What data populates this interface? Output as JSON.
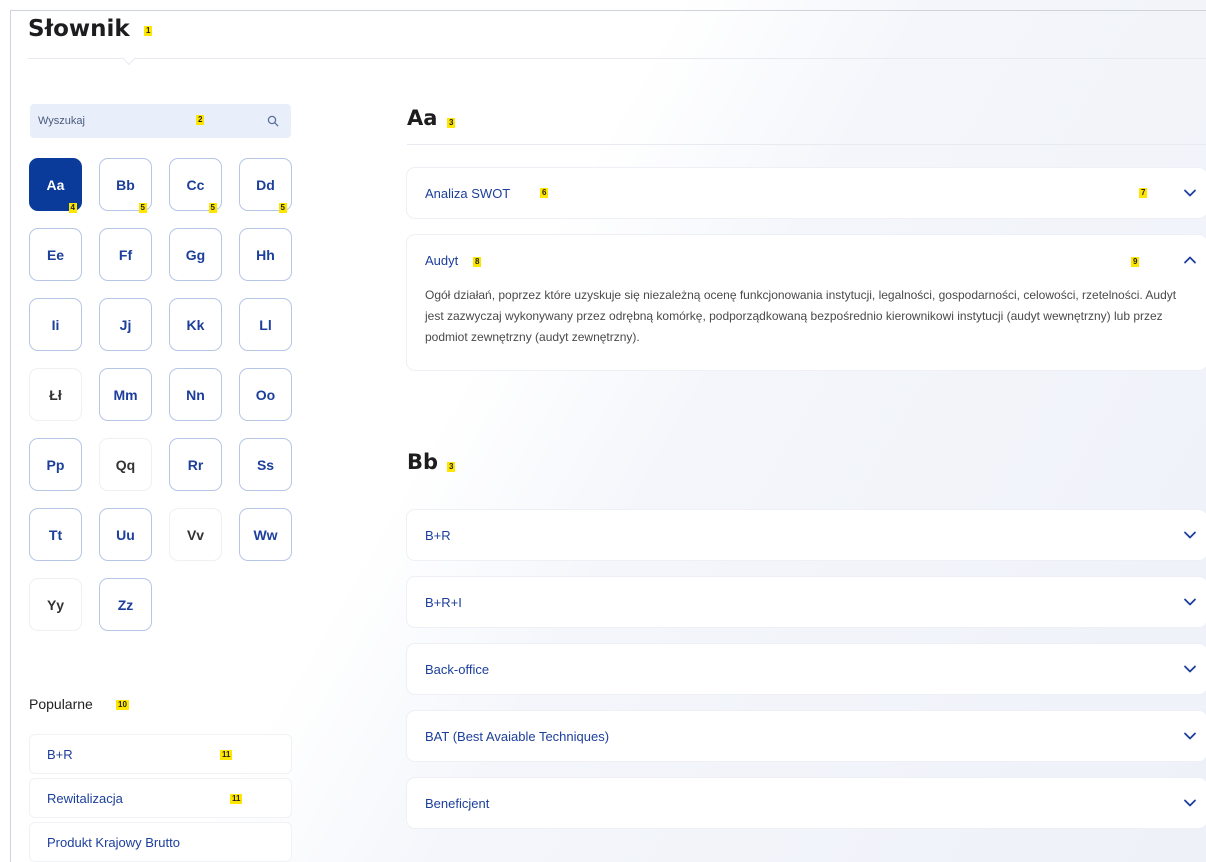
{
  "header": {
    "title": "Słownik",
    "title_marker": "1"
  },
  "search": {
    "placeholder": "Wyszukaj",
    "marker": "2"
  },
  "letters": [
    {
      "label": "Aa",
      "state": "active",
      "marker": "4"
    },
    {
      "label": "Bb",
      "state": "enabled",
      "marker": "5"
    },
    {
      "label": "Cc",
      "state": "enabled",
      "marker": "5"
    },
    {
      "label": "Dd",
      "state": "enabled",
      "marker": "5"
    },
    {
      "label": "Ee",
      "state": "enabled"
    },
    {
      "label": "Ff",
      "state": "enabled"
    },
    {
      "label": "Gg",
      "state": "enabled"
    },
    {
      "label": "Hh",
      "state": "enabled"
    },
    {
      "label": "Ii",
      "state": "enabled"
    },
    {
      "label": "Jj",
      "state": "enabled"
    },
    {
      "label": "Kk",
      "state": "enabled"
    },
    {
      "label": "Ll",
      "state": "enabled"
    },
    {
      "label": "Łł",
      "state": "disabled"
    },
    {
      "label": "Mm",
      "state": "enabled"
    },
    {
      "label": "Nn",
      "state": "enabled"
    },
    {
      "label": "Oo",
      "state": "enabled"
    },
    {
      "label": "Pp",
      "state": "enabled"
    },
    {
      "label": "Qq",
      "state": "disabled"
    },
    {
      "label": "Rr",
      "state": "enabled"
    },
    {
      "label": "Ss",
      "state": "enabled"
    },
    {
      "label": "Tt",
      "state": "enabled"
    },
    {
      "label": "Uu",
      "state": "enabled"
    },
    {
      "label": "Vv",
      "state": "disabled"
    },
    {
      "label": "Ww",
      "state": "enabled"
    },
    {
      "label": "Yy",
      "state": "disabled"
    },
    {
      "label": "Zz",
      "state": "enabled"
    }
  ],
  "popular": {
    "title": "Popularne",
    "marker": "10",
    "items": [
      {
        "label": "B+R",
        "marker": "11"
      },
      {
        "label": "Rewitalizacja",
        "marker": "11"
      },
      {
        "label": "Produkt Krajowy Brutto"
      }
    ]
  },
  "sections": {
    "aa": {
      "title": "Aa",
      "marker": "3",
      "items": {
        "swot": {
          "label": "Analiza SWOT",
          "marker": "6",
          "chevron_marker": "7",
          "expanded": false
        },
        "audyt": {
          "label": "Audyt",
          "marker": "8",
          "chevron_marker": "9",
          "expanded": true,
          "body": "Ogół działań, poprzez które uzyskuje się niezależną ocenę funkcjonowania instytucji, legalności, gospodarności, celowości, rzetelności. Audyt jest zazwyczaj wykonywany przez odrębną komórkę, podporządkowaną bezpośrednio kierownikowi instytucji (audyt wewnętrzny) lub przez podmiot zewnętrzny (audyt zewnętrzny)."
        }
      }
    },
    "bb": {
      "title": "Bb",
      "marker": "3",
      "items": [
        {
          "label": "B+R"
        },
        {
          "label": "B+R+I"
        },
        {
          "label": "Back-office"
        },
        {
          "label": "BAT (Best Avaiable Techniques)"
        },
        {
          "label": "Beneficjent"
        }
      ]
    }
  },
  "colors": {
    "accent": "#0a3a9a",
    "link": "#1c3f9c",
    "marker": "#ffe600"
  },
  "icons": {
    "search": "search-icon",
    "expand": "chevron-down-icon",
    "collapse": "chevron-up-icon"
  }
}
